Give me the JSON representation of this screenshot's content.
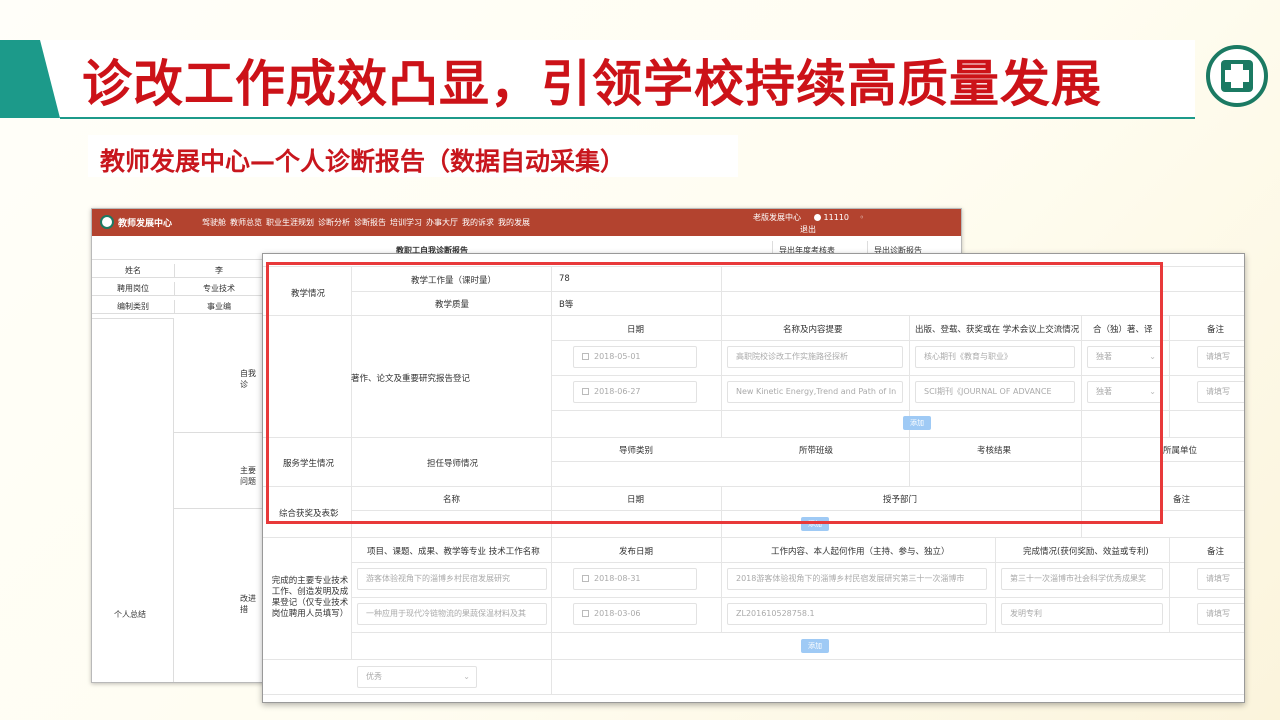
{
  "slide": {
    "title": "诊改工作成效凸显，引领学校持续高质量发展",
    "subtitle": "教师发展中心—个人诊断报告（数据自动采集）",
    "accent_color": "#1c9a8a",
    "title_color": "#cc1218",
    "logo_icon": "school-emblem-icon"
  },
  "back_window": {
    "brand": "教师发展中心",
    "nav": [
      "驾驶舱",
      "教师总览",
      "职业生涯规划",
      "诊断分析",
      "诊断报告",
      "培训学习",
      "办事大厅",
      "我的诉求",
      "我的发展"
    ],
    "user_label": "老版发展中心",
    "user_id": "11110",
    "logout": "退出",
    "report_title": "教职工自我诊断报告",
    "btn_export_annual": "导出年度考核表",
    "btn_export_report": "导出诊断报告",
    "rows": [
      {
        "label": "姓名",
        "value": "李"
      },
      {
        "label": "聘用岗位",
        "value": "专业技术"
      },
      {
        "label": "编制类别",
        "value": "事业编"
      }
    ],
    "side_label": "个人总结",
    "sub_sections": [
      "自我诊",
      "主要问题",
      "改进措"
    ]
  },
  "front_window": {
    "teaching": {
      "section": "教学情况",
      "workload_label": "教学工作量（课时量）",
      "workload_value": "78",
      "quality_label": "教学质量",
      "quality_value": "B等"
    },
    "publications": {
      "section": "著作、论文及重要研究报告登记",
      "headers": [
        "日期",
        "名称及内容提要",
        "出版、登载、获奖或在 学术会议上交流情况",
        "合（独）著、译",
        "备注"
      ],
      "rows": [
        {
          "date": "2018-05-01",
          "name": "高职院校诊改工作实施路径探析",
          "venue": "核心期刊《教育与职业》",
          "type": "独著",
          "note": "请填写"
        },
        {
          "date": "2018-06-27",
          "name": "New Kinetic Energy,Trend and Path of In",
          "venue": "SCI期刊《JOURNAL OF ADVANCE",
          "type": "独著",
          "note": "请填写"
        }
      ],
      "add": "添加"
    },
    "service": {
      "section": "服务学生情况",
      "sub": "担任导师情况",
      "headers": [
        "导师类别",
        "所带班级",
        "考核结果",
        "所属单位"
      ]
    },
    "awards": {
      "section": "综合获奖及表彰",
      "headers": [
        "名称",
        "日期",
        "授予部门",
        "备注"
      ],
      "add": "添加"
    },
    "projects": {
      "section": "完成的主要专业技术工作、创造发明及成果登记（仅专业技术岗位聘用人员填写）",
      "headers": [
        "项目、课题、成果、教学等专业 技术工作名称",
        "发布日期",
        "工作内容、本人起何作用（主持、参与、独立）",
        "完成情况(获何奖励、效益或专利)",
        "备注"
      ],
      "rows": [
        {
          "name": "游客体验视角下的淄博乡村民宿发展研究",
          "date": "2018-08-31",
          "content": "2018游客体验视角下的淄博乡村民宿发展研究第三十一次淄博市",
          "result": "第三十一次淄博市社会科学优秀成果奖",
          "note": "请填写"
        },
        {
          "name": "一种应用于现代冷链物流的果蔬保温材料及其",
          "date": "2018-03-06",
          "content": "ZL201610528758.1",
          "result": "发明专利",
          "note": "请填写"
        }
      ],
      "add": "添加"
    },
    "rating": {
      "value": "优秀"
    }
  }
}
